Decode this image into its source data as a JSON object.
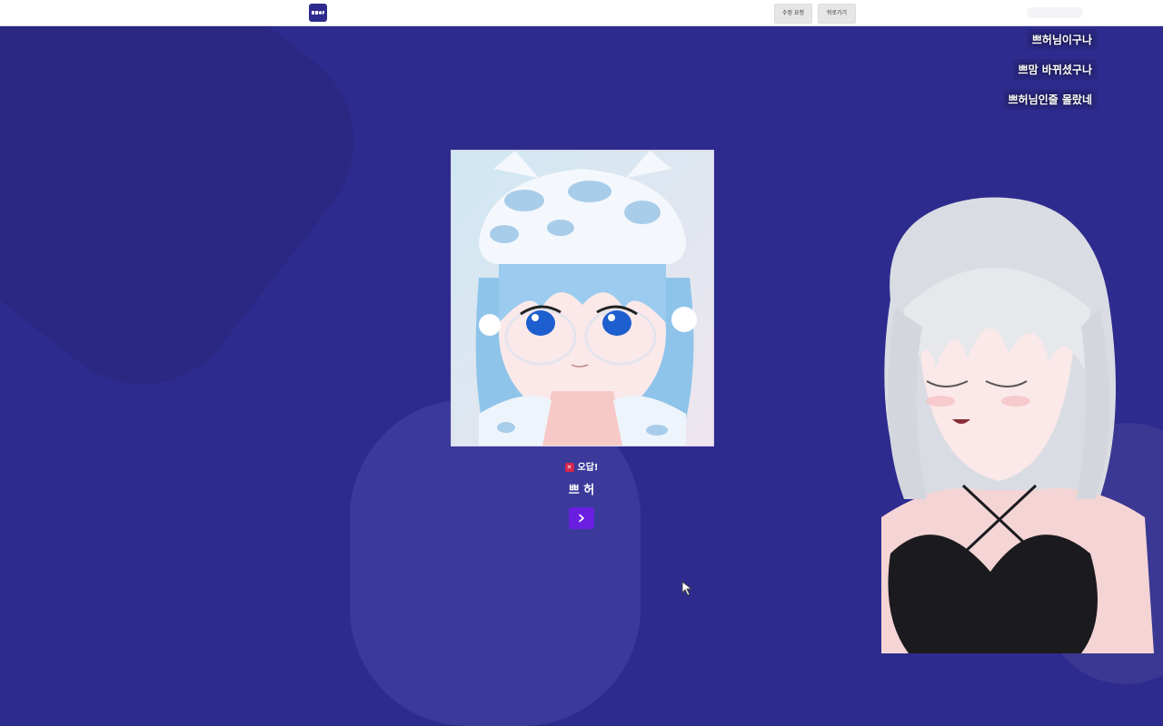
{
  "topbar": {
    "logo_icon": "app-logo-icon",
    "fix_request_label": "수정 요청",
    "back_label": "뒤로가기"
  },
  "chat": {
    "messages": [
      "쁘허님이구나",
      "쁘맘 바뀌셨구나",
      "쁘허님인줄 몰랐네"
    ]
  },
  "quiz": {
    "result_label": "오답!",
    "result_icon": "x-mark-icon",
    "answer": "쁘 허",
    "next_icon": "chevron-right-icon"
  },
  "colors": {
    "background": "#2e2b8f",
    "accent": "#6a1fe0",
    "wrong": "#d6244a"
  }
}
